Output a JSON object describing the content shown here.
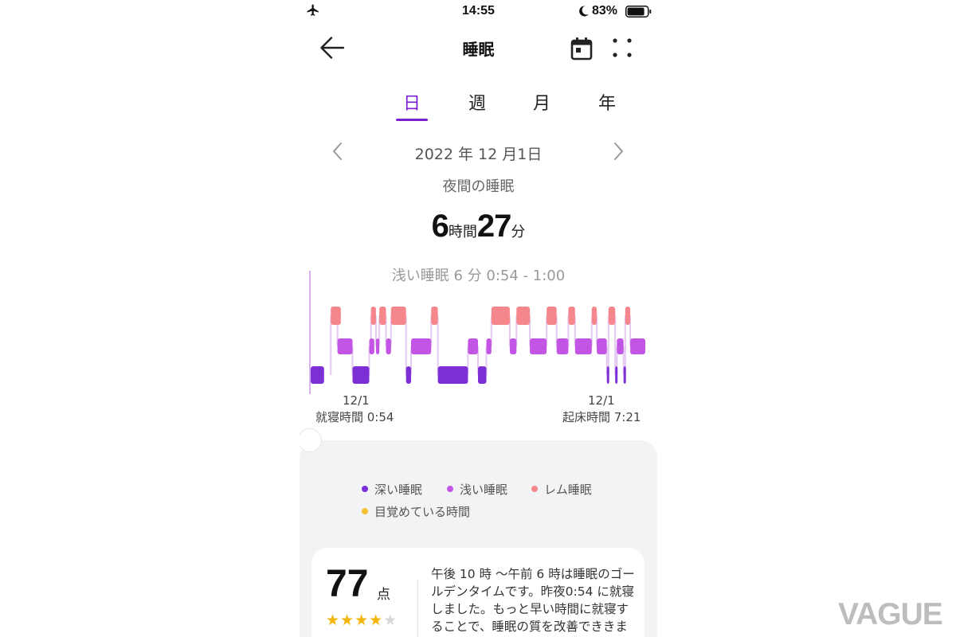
{
  "status_bar": {
    "time": "14:55",
    "battery": "83%"
  },
  "header": {
    "title": "睡眠"
  },
  "tabs": [
    {
      "label": "日",
      "active": true
    },
    {
      "label": "週",
      "active": false
    },
    {
      "label": "月",
      "active": false
    },
    {
      "label": "年",
      "active": false
    }
  ],
  "date": {
    "text": "2022 年 12 月1日"
  },
  "sleep_type": "夜間の睡眠",
  "duration": {
    "hours": "6",
    "hours_unit": "時間",
    "minutes": "27",
    "minutes_unit": "分"
  },
  "selected_segment": "浅い睡眠 6 分 0:54 - 1:00",
  "chart_data": {
    "type": "timeline",
    "start_label": {
      "date": "12/1",
      "text": "就寝時間 0:54"
    },
    "end_label": {
      "date": "12/1",
      "text": "起床時間 7:21"
    },
    "levels": [
      "レム睡眠",
      "浅い睡眠",
      "深い睡眠"
    ],
    "colors": {
      "deep": "#7d2fd6",
      "light": "#c255e3",
      "rem": "#f5868c",
      "awake": "#f2c230"
    },
    "segments": [
      {
        "stage": "deep",
        "start": 0.0,
        "end": 0.04
      },
      {
        "stage": "rem",
        "start": 0.06,
        "end": 0.09
      },
      {
        "stage": "light",
        "start": 0.08,
        "end": 0.125
      },
      {
        "stage": "deep",
        "start": 0.125,
        "end": 0.175
      },
      {
        "stage": "light",
        "start": 0.175,
        "end": 0.19
      },
      {
        "stage": "rem",
        "start": 0.18,
        "end": 0.195
      },
      {
        "stage": "light",
        "start": 0.195,
        "end": 0.205
      },
      {
        "stage": "rem",
        "start": 0.205,
        "end": 0.225
      },
      {
        "stage": "light",
        "start": 0.225,
        "end": 0.24
      },
      {
        "stage": "rem",
        "start": 0.24,
        "end": 0.285
      },
      {
        "stage": "deep",
        "start": 0.285,
        "end": 0.3
      },
      {
        "stage": "light",
        "start": 0.3,
        "end": 0.36
      },
      {
        "stage": "rem",
        "start": 0.36,
        "end": 0.38
      },
      {
        "stage": "deep",
        "start": 0.38,
        "end": 0.47
      },
      {
        "stage": "light",
        "start": 0.47,
        "end": 0.5
      },
      {
        "stage": "deep",
        "start": 0.5,
        "end": 0.525
      },
      {
        "stage": "light",
        "start": 0.525,
        "end": 0.54
      },
      {
        "stage": "rem",
        "start": 0.54,
        "end": 0.595
      },
      {
        "stage": "light",
        "start": 0.595,
        "end": 0.615
      },
      {
        "stage": "rem",
        "start": 0.615,
        "end": 0.655
      },
      {
        "stage": "light",
        "start": 0.655,
        "end": 0.705
      },
      {
        "stage": "rem",
        "start": 0.705,
        "end": 0.735
      },
      {
        "stage": "light",
        "start": 0.735,
        "end": 0.77
      },
      {
        "stage": "rem",
        "start": 0.77,
        "end": 0.79
      },
      {
        "stage": "light",
        "start": 0.79,
        "end": 0.84
      },
      {
        "stage": "rem",
        "start": 0.84,
        "end": 0.855
      },
      {
        "stage": "light",
        "start": 0.855,
        "end": 0.885
      },
      {
        "stage": "deep",
        "start": 0.885,
        "end": 0.89
      },
      {
        "stage": "rem",
        "start": 0.89,
        "end": 0.91
      },
      {
        "stage": "deep",
        "start": 0.91,
        "end": 0.915
      },
      {
        "stage": "light",
        "start": 0.915,
        "end": 0.935
      },
      {
        "stage": "deep",
        "start": 0.935,
        "end": 0.94
      },
      {
        "stage": "rem",
        "start": 0.94,
        "end": 0.955
      },
      {
        "stage": "light",
        "start": 0.955,
        "end": 1.0
      }
    ]
  },
  "legend": [
    {
      "label": "深い睡眠",
      "color": "#7d2fd6"
    },
    {
      "label": "浅い睡眠",
      "color": "#c255e3"
    },
    {
      "label": "レム睡眠",
      "color": "#f5868c"
    },
    {
      "label": "目覚めている時間",
      "color": "#f2c230"
    }
  ],
  "score_card": {
    "score": "77",
    "unit": "点",
    "stars_filled": 4,
    "stars_total": 5,
    "advice": "午後 10 時 〜午前 6 時は睡眠のゴールデンタイムです。昨夜0:54 に就寝しました。もっと早い時間に就寝することで、睡眠の質を改善でききます。"
  },
  "watermark": "VAGUE"
}
